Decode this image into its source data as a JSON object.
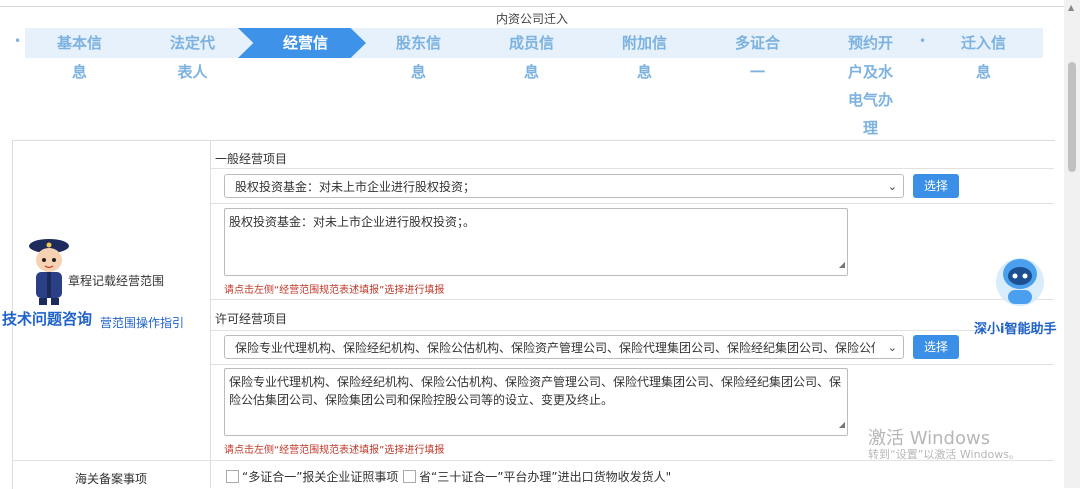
{
  "page_title": "内资公司迁入",
  "steps": [
    {
      "l1": "基本信",
      "l2": "息",
      "l3": "",
      "l4": "",
      "active": false
    },
    {
      "l1": "法定代",
      "l2": "表人",
      "l3": "",
      "l4": "",
      "active": false
    },
    {
      "l1": "经营信",
      "l2": "",
      "l3": "",
      "l4": "",
      "active": true
    },
    {
      "l1": "股东信",
      "l2": "息",
      "l3": "",
      "l4": "",
      "active": false
    },
    {
      "l1": "成员信",
      "l2": "息",
      "l3": "",
      "l4": "",
      "active": false
    },
    {
      "l1": "附加信",
      "l2": "息",
      "l3": "",
      "l4": "",
      "active": false
    },
    {
      "l1": "多证合",
      "l2": "一",
      "l3": "",
      "l4": "",
      "active": false
    },
    {
      "l1": "预约开",
      "l2": "户及水",
      "l3": "电气办",
      "l4": "理",
      "active": false
    },
    {
      "l1": "迁入信",
      "l2": "息",
      "l3": "",
      "l4": "",
      "active": false
    }
  ],
  "left": {
    "charter_label": "章程记载经营范围",
    "tech_consult": "技术问题咨询",
    "guide_link": "营范围操作指引",
    "customs_label": "海关备案事项"
  },
  "general": {
    "label": "一般经营项目",
    "select_value": "股权投资基金：对未上市企业进行股权投资；",
    "select_button": "选择",
    "textarea_value": "股权投资基金：对未上市企业进行股权投资；。",
    "hint": "请点击左侧“经营范围规范表述填报”选择进行填报"
  },
  "licensed": {
    "label": "许可经营项目",
    "select_value": "保险专业代理机构、保险经纪机构、保险公估机构、保险资产管理公司、保险代理集团公司、保险经纪集团公司、保险公估集",
    "select_button": "选择",
    "textarea_value": "保险专业代理机构、保险经纪机构、保险公估机构、保险资产管理公司、保险代理集团公司、保险经纪集团公司、保险公估集团公司、保险集团公司和保险控股公司等的设立、变更及终止。",
    "hint": "请点击左侧“经营范围规范表述填报”选择进行填报"
  },
  "customs": {
    "option1": "“多证合一”报关企业证照事项",
    "option2": "省“三十证合一”平台办理”进出口货物收发货人\""
  },
  "assistant": {
    "label": "深小i智能助手"
  },
  "watermark": {
    "line1": "激活 Windows",
    "line2": "转到“设置”以激活 Windows。"
  },
  "colors": {
    "accent": "#3e93e8",
    "step_text": "#7db2e0",
    "hint_red": "#c0392b",
    "link_blue": "#1f62c9"
  },
  "icons": {
    "police": "police-mascot-icon",
    "robot": "robot-assistant-icon"
  }
}
